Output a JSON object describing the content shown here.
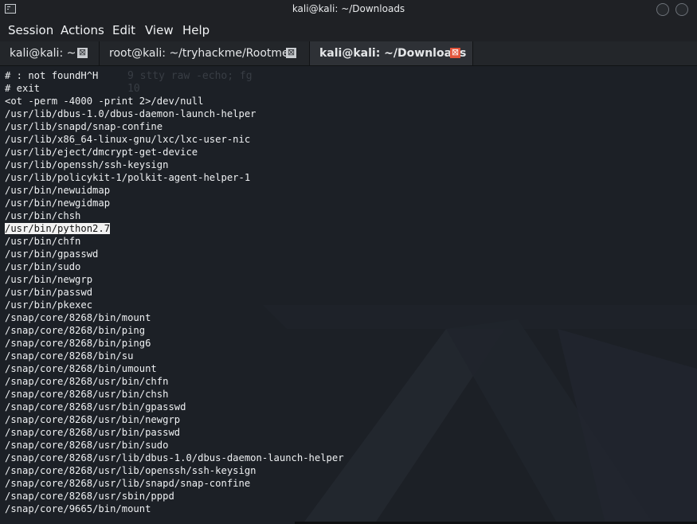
{
  "window": {
    "title": "kali@kali: ~/Downloads",
    "app_icon": "terminal-icon",
    "controls": [
      "minimize-icon",
      "maximize-icon"
    ]
  },
  "menu": {
    "items": [
      "Session",
      "Actions",
      "Edit",
      "View",
      "Help"
    ]
  },
  "tabs": [
    {
      "label": "kali@kali: ~",
      "close_glyph": "⊠"
    },
    {
      "label": "root@kali: ~/tryhackme/Rootme",
      "close_glyph": "⊠"
    },
    {
      "label": "kali@kali: ~/Downloads",
      "close_glyph": "⊠"
    }
  ],
  "background_ghost": [
    "9 stty raw -echo; fg",
    "10"
  ],
  "terminal": {
    "highlighted_index": 12,
    "lines": [
      "# : not foundH^H",
      "# exit",
      "<ot -perm -4000 -print 2>/dev/null",
      "/usr/lib/dbus-1.0/dbus-daemon-launch-helper",
      "/usr/lib/snapd/snap-confine",
      "/usr/lib/x86_64-linux-gnu/lxc/lxc-user-nic",
      "/usr/lib/eject/dmcrypt-get-device",
      "/usr/lib/openssh/ssh-keysign",
      "/usr/lib/policykit-1/polkit-agent-helper-1",
      "/usr/bin/newuidmap",
      "/usr/bin/newgidmap",
      "/usr/bin/chsh",
      "/usr/bin/python2.7",
      "/usr/bin/chfn",
      "/usr/bin/gpasswd",
      "/usr/bin/sudo",
      "/usr/bin/newgrp",
      "/usr/bin/passwd",
      "/usr/bin/pkexec",
      "/snap/core/8268/bin/mount",
      "/snap/core/8268/bin/ping",
      "/snap/core/8268/bin/ping6",
      "/snap/core/8268/bin/su",
      "/snap/core/8268/bin/umount",
      "/snap/core/8268/usr/bin/chfn",
      "/snap/core/8268/usr/bin/chsh",
      "/snap/core/8268/usr/bin/gpasswd",
      "/snap/core/8268/usr/bin/newgrp",
      "/snap/core/8268/usr/bin/passwd",
      "/snap/core/8268/usr/bin/sudo",
      "/snap/core/8268/usr/lib/dbus-1.0/dbus-daemon-launch-helper",
      "/snap/core/8268/usr/lib/openssh/ssh-keysign",
      "/snap/core/8268/usr/lib/snapd/snap-confine",
      "/snap/core/8268/usr/sbin/pppd",
      "/snap/core/9665/bin/mount"
    ]
  }
}
